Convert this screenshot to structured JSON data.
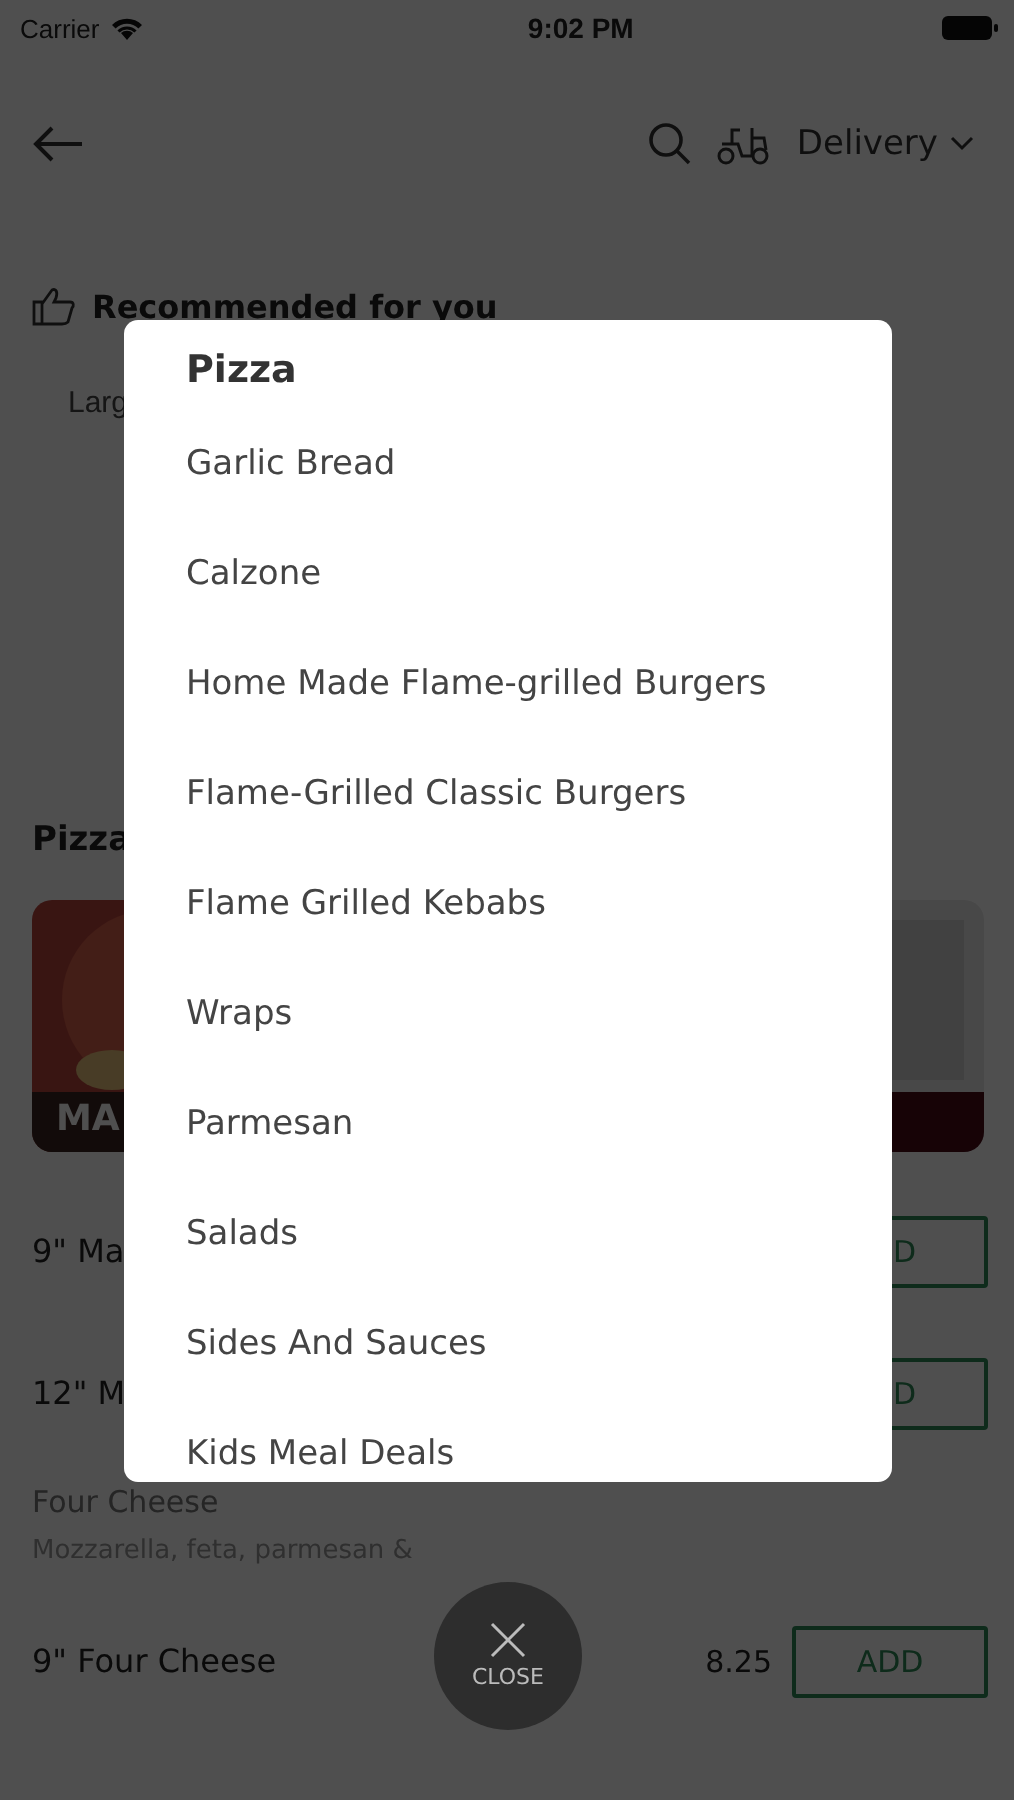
{
  "status_bar": {
    "carrier": "Carrier",
    "time": "9:02 PM"
  },
  "header": {
    "order_mode": "Delivery"
  },
  "recommended": {
    "title": "Recommended for you",
    "items": [
      "Larg"
    ]
  },
  "section": {
    "title": "Pizza",
    "featured_caption": "MA"
  },
  "menu": [
    {
      "kind": "item",
      "name": "9\" Ma",
      "button": "D"
    },
    {
      "kind": "item",
      "name": "12\" M",
      "button": "D"
    },
    {
      "kind": "group",
      "name": "Four Cheese",
      "description": "Mozzarella, feta, parmesan &"
    },
    {
      "kind": "item",
      "name": "9\" Four Cheese",
      "price": "8.25",
      "button": "ADD"
    }
  ],
  "category_menu": {
    "title": "Pizza",
    "items": [
      "Garlic Bread",
      "Calzone",
      "Home Made Flame-grilled Burgers",
      "Flame-Grilled Classic Burgers",
      "Flame Grilled Kebabs",
      "Wraps",
      "Parmesan",
      "Salads",
      "Sides And Sauces",
      "Kids Meal Deals"
    ]
  },
  "close_button": {
    "label": "CLOSE"
  }
}
